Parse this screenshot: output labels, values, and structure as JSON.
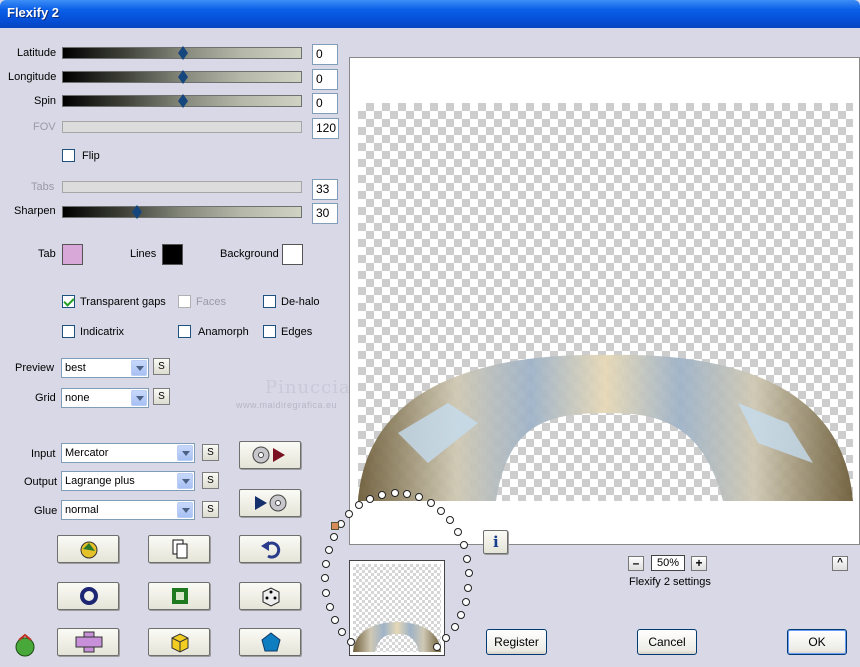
{
  "window": {
    "title": "Flexify 2"
  },
  "params": {
    "latitude": {
      "label": "Latitude",
      "value": "0",
      "level": 0.5
    },
    "longitude": {
      "label": "Longitude",
      "value": "0",
      "level": 0.5
    },
    "spin": {
      "label": "Spin",
      "value": "0",
      "level": 0.5
    },
    "fov": {
      "label": "FOV",
      "value": "120"
    },
    "flip": {
      "label": "Flip",
      "checked": false
    },
    "tabs": {
      "label": "Tabs",
      "value": "33"
    },
    "sharpen": {
      "label": "Sharpen",
      "value": "30",
      "level": 0.3
    }
  },
  "colors": {
    "tab": {
      "label": "Tab",
      "color": "#d8a8d8"
    },
    "lines": {
      "label": "Lines",
      "color": "#000000"
    },
    "background": {
      "label": "Background",
      "color": "#ffffff"
    }
  },
  "options": {
    "transparent_gaps": {
      "label": "Transparent gaps",
      "checked": true
    },
    "faces": {
      "label": "Faces",
      "checked": false
    },
    "dehalo": {
      "label": "De-halo",
      "checked": false
    },
    "indicatrix": {
      "label": "Indicatrix",
      "checked": false
    },
    "anamorph": {
      "label": "Anamorph",
      "checked": false
    },
    "edges": {
      "label": "Edges",
      "checked": false
    }
  },
  "dropdowns": {
    "preview": {
      "label": "Preview",
      "value": "best"
    },
    "grid": {
      "label": "Grid",
      "value": "none"
    },
    "input": {
      "label": "Input",
      "value": "Mercator"
    },
    "output": {
      "label": "Output",
      "value": "Lagrange plus"
    },
    "glue": {
      "label": "Glue",
      "value": "normal"
    }
  },
  "small_s": "S",
  "watermark": {
    "name": "Pinuccia",
    "site": "www.maidiregrafica.eu"
  },
  "zoom": {
    "value": "50%",
    "minus": "–",
    "plus": "+"
  },
  "collapse_label": "^",
  "info_label": "i",
  "status": "Flexify 2 settings",
  "buttons": {
    "register": "Register",
    "cancel": "Cancel",
    "ok": "OK"
  }
}
